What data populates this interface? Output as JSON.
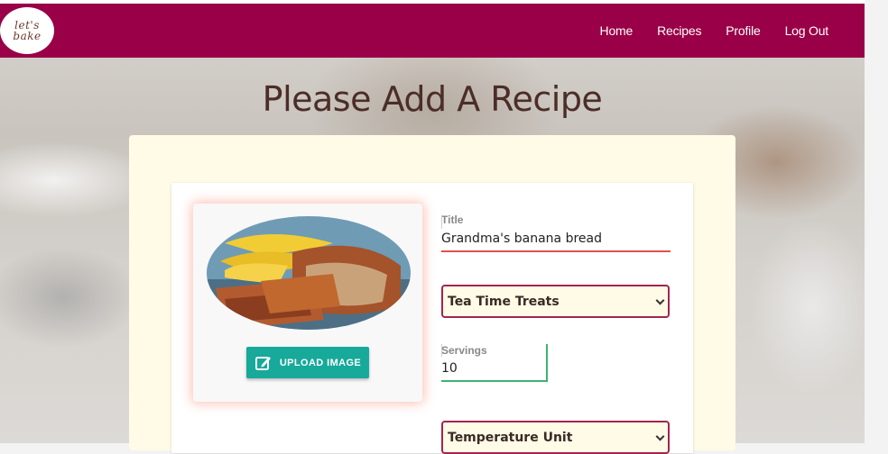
{
  "brand": {
    "logo_line1": "let's",
    "logo_line2": "bake"
  },
  "nav": {
    "items": [
      {
        "label": "Home"
      },
      {
        "label": "Recipes"
      },
      {
        "label": "Profile"
      },
      {
        "label": "Log Out"
      }
    ]
  },
  "page": {
    "title": "Please Add A Recipe"
  },
  "image_panel": {
    "upload_label": "UPLOAD IMAGE"
  },
  "form": {
    "title_label": "Title",
    "title_value": "Grandma's banana bread",
    "category_selected": "Tea Time Treats",
    "servings_label": "Servings",
    "servings_value": "10",
    "temperature_selected": "Temperature Unit"
  },
  "colors": {
    "navbar": "#990047",
    "accent_button": "#17a99a",
    "select_border": "#a3244f",
    "panel_cream": "#fffbe6",
    "title_underline": "#e0524d",
    "servings_underline": "#3cb371"
  }
}
